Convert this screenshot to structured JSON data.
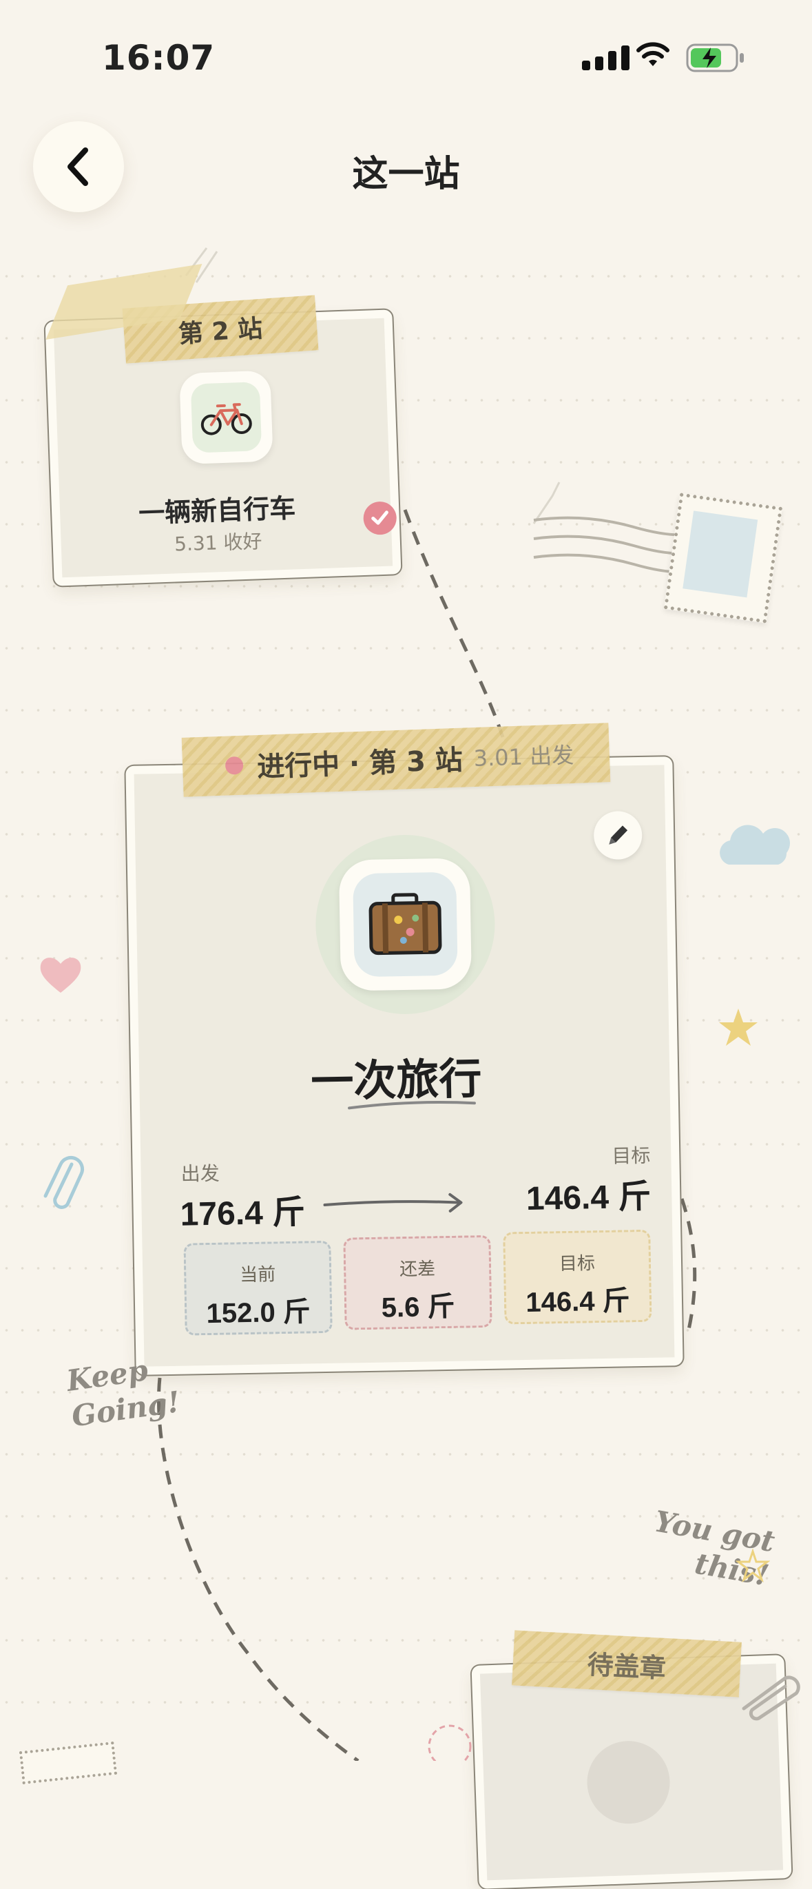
{
  "status_bar": {
    "time": "16:07"
  },
  "header": {
    "title": "这一站"
  },
  "prev_station": {
    "tape_label": "第 2 站",
    "name": "一辆新自行车",
    "date": "5.31 收好"
  },
  "current_station": {
    "tape_status": "进行中 · 第 3 站",
    "tape_date": "3.01 出发",
    "name": "一次旅行",
    "start_label": "出发",
    "start_value": "176.4 斤",
    "target_label": "目标",
    "target_value": "146.4 斤",
    "pills": [
      {
        "label": "当前",
        "value": "152.0 斤",
        "bg": "#e3e4de",
        "border": "#b9c3c6"
      },
      {
        "label": "还差",
        "value": "5.6 斤",
        "bg": "#eee0da",
        "border": "#d8a7a7"
      },
      {
        "label": "目标",
        "value": "146.4 斤",
        "bg": "#f1e7cf",
        "border": "#e3d09e"
      }
    ]
  },
  "next_station": {
    "tape_label": "待盖章"
  },
  "stickers": {
    "keep_going": "Keep\nGoing!",
    "you_got_this": "You got\nthis!"
  },
  "colors": {
    "background": "#f8f4ec",
    "tape": "#e8d39a",
    "check": "#e58a93",
    "dot": "#e58a93"
  }
}
